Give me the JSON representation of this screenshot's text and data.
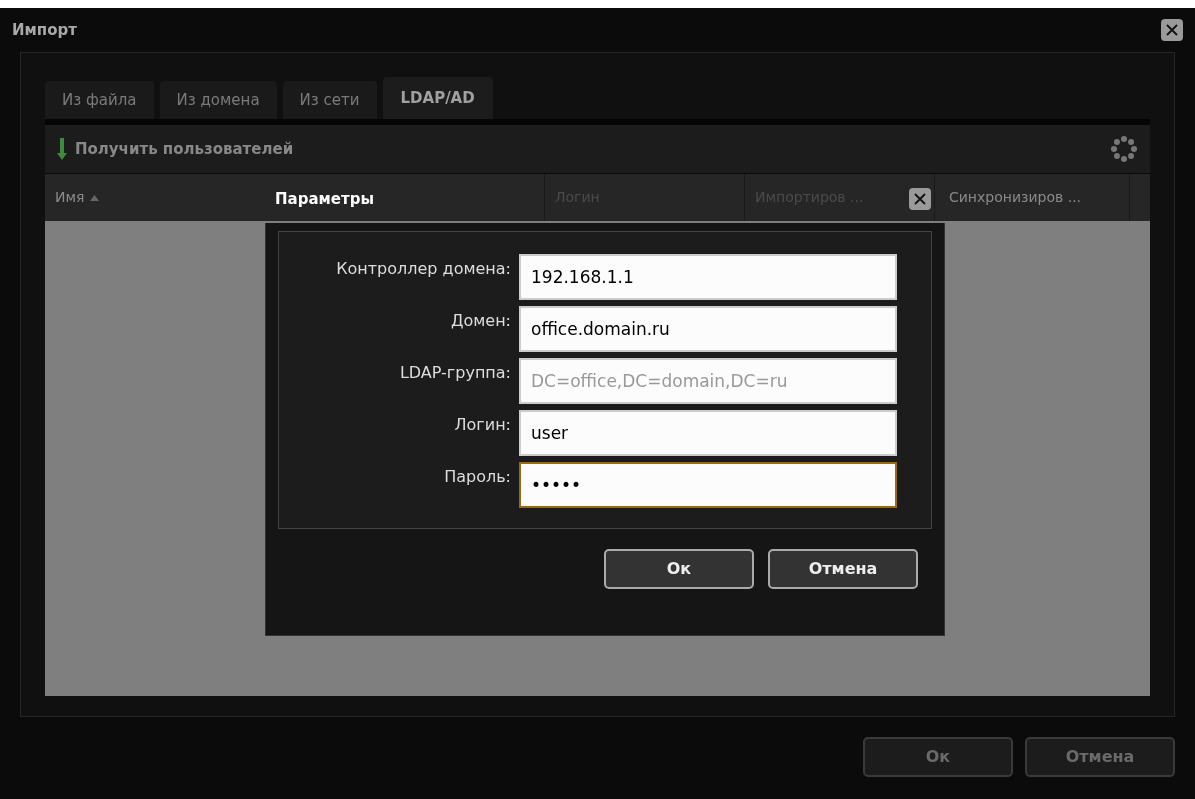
{
  "window": {
    "title": "Импорт"
  },
  "tabs": [
    {
      "label": "Из файла",
      "selected": false
    },
    {
      "label": "Из домена",
      "selected": false
    },
    {
      "label": "Из сети",
      "selected": false
    },
    {
      "label": "LDAP/AD",
      "selected": true
    }
  ],
  "toolbar": {
    "action": "Получить пользователей"
  },
  "table": {
    "columns": [
      {
        "label": "Имя",
        "sorted": true
      },
      {
        "label": "Логин",
        "sorted": false
      },
      {
        "label": "Импортиров ...",
        "sorted": false
      },
      {
        "label": "Синхронизиров ...",
        "sorted": false
      }
    ]
  },
  "dialog": {
    "title": "Параметры",
    "fields": [
      {
        "label": "Контроллер домена:",
        "value": "192.168.1.1",
        "focused": false
      },
      {
        "label": "Домен:",
        "value": "office.domain.ru",
        "focused": false
      },
      {
        "label": "LDAP-группа:",
        "placeholder": "DC=office,DC=domain,DC=ru",
        "focused": false
      },
      {
        "label": "Логин:",
        "value": "user",
        "focused": false
      },
      {
        "label": "Пароль:",
        "value": "•••••",
        "focused": true
      }
    ],
    "buttons": [
      "Ок",
      "Отмена"
    ]
  },
  "buttons": [
    "Ок",
    "Отмена"
  ]
}
